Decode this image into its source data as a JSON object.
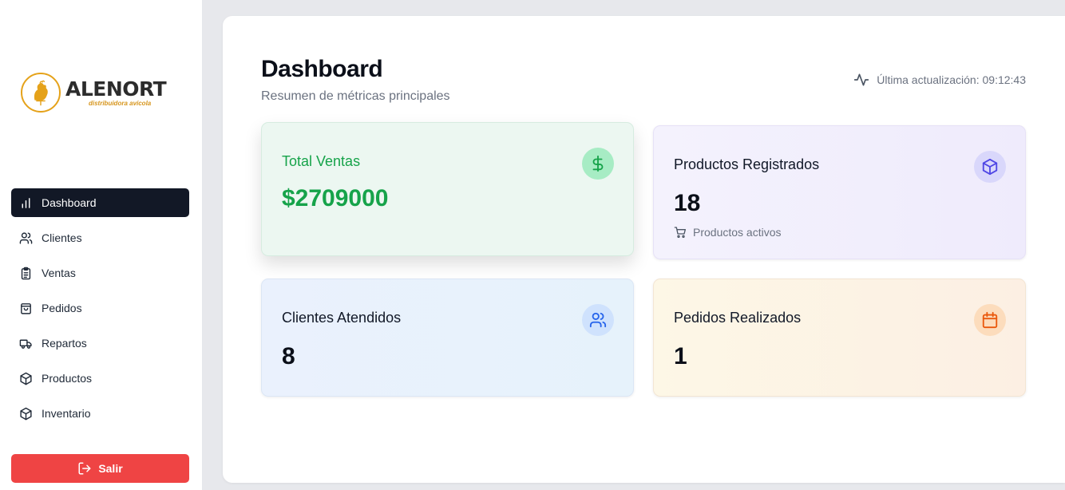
{
  "brand": {
    "name": "ALENORT",
    "tagline": "distribuidora avícola",
    "accent": "#e5a21a"
  },
  "sidebar": {
    "items": [
      {
        "label": "Dashboard",
        "icon": "bar-chart-icon",
        "active": true
      },
      {
        "label": "Clientes",
        "icon": "users-icon"
      },
      {
        "label": "Ventas",
        "icon": "clipboard-icon"
      },
      {
        "label": "Pedidos",
        "icon": "shopping-bag-icon"
      },
      {
        "label": "Repartos",
        "icon": "truck-icon"
      },
      {
        "label": "Productos",
        "icon": "package-icon"
      },
      {
        "label": "Inventario",
        "icon": "package-icon"
      }
    ],
    "logout_label": "Salir"
  },
  "header": {
    "title": "Dashboard",
    "subtitle": "Resumen de métricas principales",
    "updated_label": "Última actualización: 09:12:43"
  },
  "cards": {
    "ventas": {
      "label": "Total Ventas",
      "value": "$2709000",
      "icon": "dollar-icon",
      "color": "#16a34a"
    },
    "productos": {
      "label": "Productos Registrados",
      "value": "18",
      "note": "Productos activos",
      "icon": "package-icon",
      "color": "#4f46e5"
    },
    "clientes": {
      "label": "Clientes Atendidos",
      "value": "8",
      "icon": "users-icon",
      "color": "#2563eb"
    },
    "pedidos": {
      "label": "Pedidos Realizados",
      "value": "1",
      "icon": "calendar-icon",
      "color": "#ea580c"
    }
  },
  "colors": {
    "sidebar_active_bg": "#121826",
    "logout_bg": "#ef4444"
  }
}
